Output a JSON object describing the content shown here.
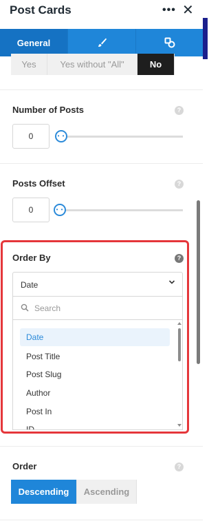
{
  "header": {
    "title": "Post Cards",
    "more_glyph": "•••",
    "close_glyph": "✕"
  },
  "tabs": [
    {
      "label": "General",
      "active": true
    },
    {
      "icon": "brush-icon"
    },
    {
      "icon": "shapes-icon"
    }
  ],
  "sticky_option": {
    "options": [
      "Yes",
      "Yes without \"All\"",
      "No"
    ],
    "selected": "No"
  },
  "number_of_posts": {
    "label": "Number of Posts",
    "value": "0"
  },
  "posts_offset": {
    "label": "Posts Offset",
    "value": "0"
  },
  "order_by": {
    "label": "Order By",
    "selected": "Date",
    "search_placeholder": "Search",
    "options": [
      "Date",
      "Post Title",
      "Post Slug",
      "Author",
      "Post In",
      "ID"
    ]
  },
  "order": {
    "label": "Order",
    "options": [
      "Descending",
      "Ascending"
    ],
    "selected": "Descending"
  },
  "colors": {
    "accent": "#1f86d9",
    "highlight": "#e5363a"
  }
}
